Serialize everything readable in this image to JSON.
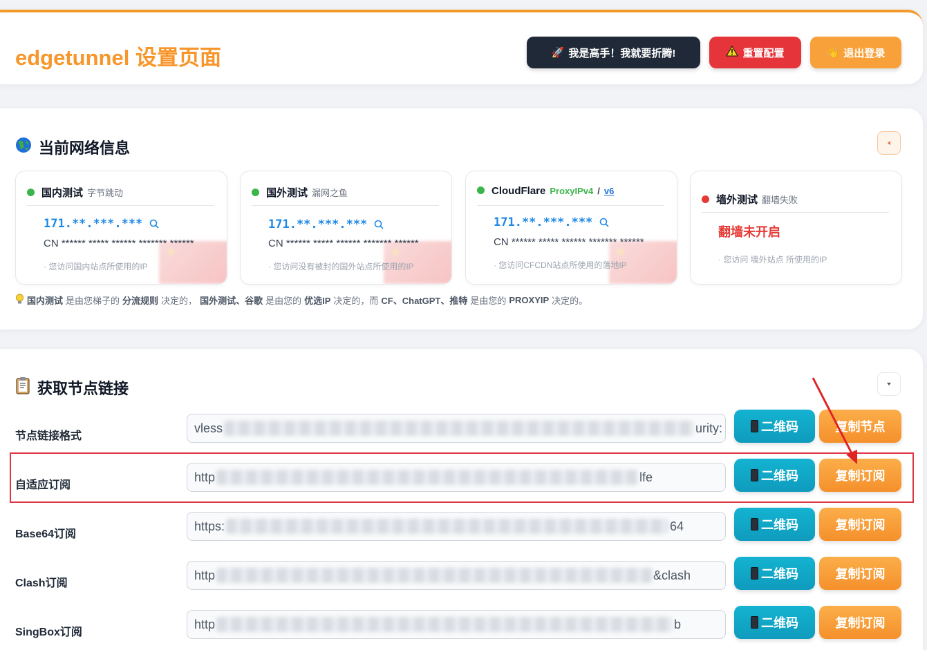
{
  "header": {
    "title": "edgetunnel 设置页面",
    "expert_button": "我是高手！我就要折腾!",
    "reset_button": "重置配置",
    "logout_button": "退出登录"
  },
  "network": {
    "title": "当前网络信息",
    "cards": [
      {
        "name": "国内测试",
        "provider": "字节跳动",
        "ip": "171.**.***.***",
        "location": "CN ****** ***** ****** ******* ******",
        "note": "· 您访问国内站点所使用的IP",
        "status": "green"
      },
      {
        "name": "国外测试",
        "provider": "漏网之鱼",
        "ip": "171.**.***.***",
        "location": "CN ****** ***** ****** ******* ******",
        "note": "· 您访问没有被封的国外站点所使用的IP",
        "status": "green"
      },
      {
        "name": "CloudFlare",
        "provider": "ProxyIPv4",
        "separator": "/",
        "provider_link": "v6",
        "ip": "171.**.***.***",
        "location": "CN ****** ***** ****** ******* ******",
        "note": "· 您访问CFCDN站点所使用的落地IP",
        "status": "green"
      },
      {
        "name": "墙外测试",
        "provider": "翻墙失败",
        "fail_text": "翻墙未开启",
        "note": "· 您访问 墙外站点 所使用的IP",
        "status": "red"
      }
    ],
    "tip": {
      "p1": "国内测试",
      "p2": "是由您梯子的",
      "p3": "分流规则",
      "p4": "决定的，",
      "p5": "国外测试、谷歌",
      "p6": "是由您的",
      "p7": "优选IP",
      "p8": "决定的，而",
      "p9": "CF、ChatGPT、推特",
      "p10": "是由您的",
      "p11": "PROXYIP",
      "p12": "决定的。"
    }
  },
  "links": {
    "title": "获取节点链接",
    "qr_label": "二维码",
    "rows": [
      {
        "label": "节点链接格式",
        "prefix": "vless",
        "suffix": "urity:",
        "copy": "复制节点"
      },
      {
        "label": "自适应订阅",
        "prefix": "http",
        "suffix": "lfe",
        "copy": "复制订阅"
      },
      {
        "label": "Base64订阅",
        "prefix": "https:",
        "suffix": "64",
        "copy": "复制订阅"
      },
      {
        "label": "Clash订阅",
        "prefix": "http",
        "suffix": "&clash",
        "copy": "复制订阅"
      },
      {
        "label": "SingBox订阅",
        "prefix": "http",
        "suffix": "b",
        "copy": "复制订阅"
      }
    ]
  },
  "colors": {
    "accent_orange": "#f7962b",
    "danger_red": "#e5353b",
    "info_cyan": "#14b3d1",
    "status_green": "#3bb54a",
    "status_red": "#e53935"
  }
}
